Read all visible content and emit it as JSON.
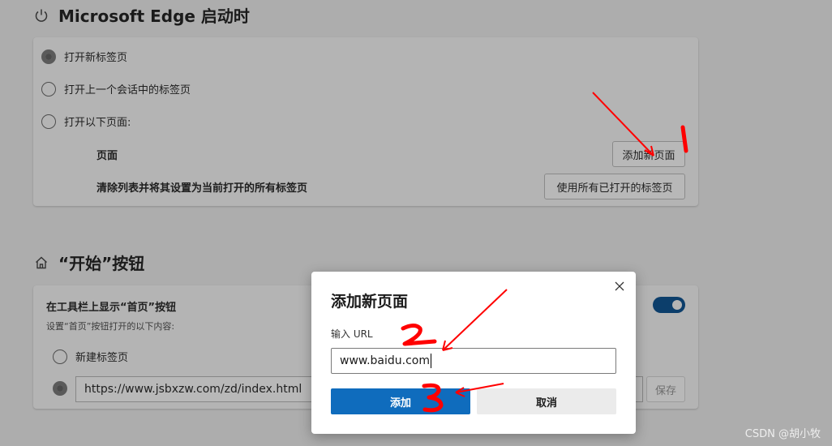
{
  "startup": {
    "title": "Microsoft Edge 启动时",
    "options": [
      "打开新标签页",
      "打开上一个会话中的标签页",
      "打开以下页面:"
    ],
    "pages_label": "页面",
    "add_page_button": "添加新页面",
    "clear_list_label": "清除列表并将其设置为当前打开的所有标签页",
    "use_open_tabs_button": "使用所有已打开的标签页"
  },
  "home_button": {
    "title": "“开始”按钮",
    "toggle_label": "在工具栏上显示“首页”按钮",
    "description": "设置“首页”按钮打开的以下内容:",
    "option_new_tab": "新建标签页",
    "url_value": "https://www.jsbxzw.com/zd/index.html",
    "save_button": "保存",
    "toggle_on": true
  },
  "dialog": {
    "title": "添加新页面",
    "input_label": "输入 URL",
    "input_value": "www.baidu.com",
    "add_button": "添加",
    "cancel_button": "取消"
  },
  "annotations": [
    "1",
    "2",
    "3"
  ],
  "watermark": "CSDN @胡小牧",
  "colors": {
    "accent": "#0f6cbd",
    "annotation": "#ff0000"
  }
}
